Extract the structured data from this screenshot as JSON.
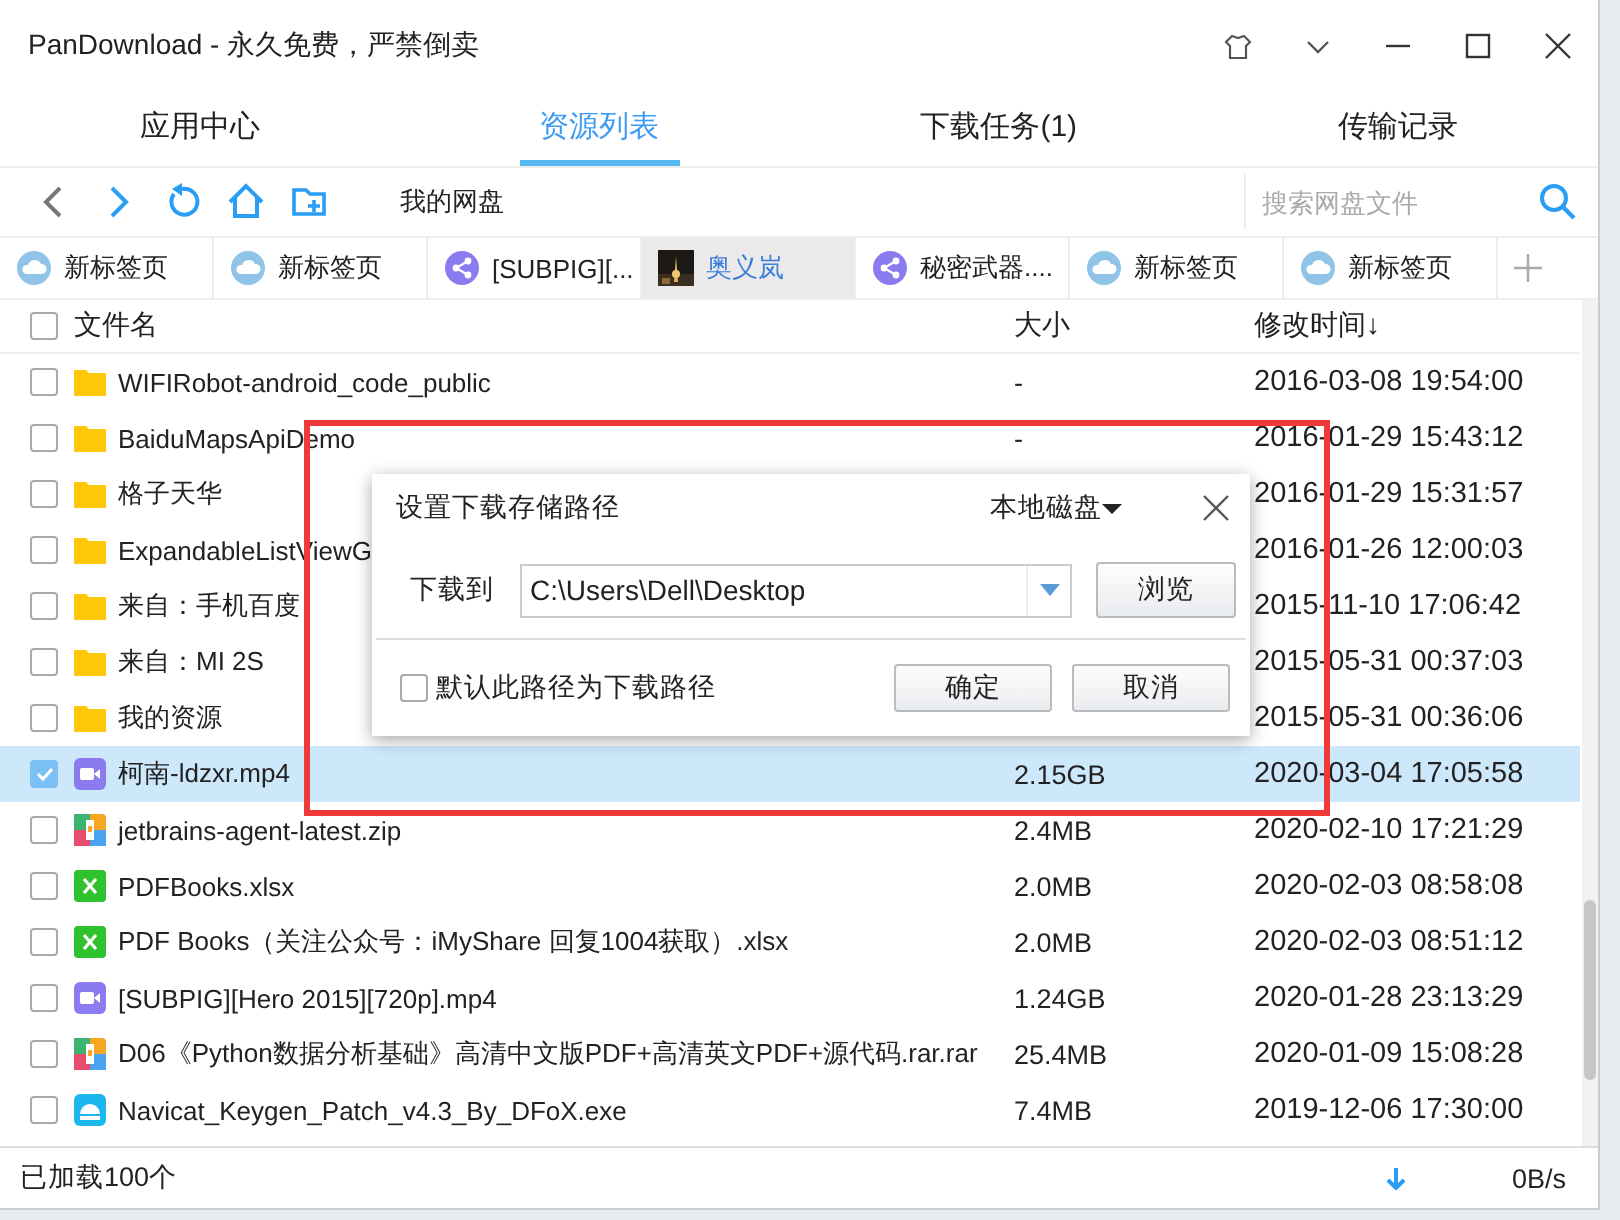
{
  "window": {
    "title": "PanDownload - 永久免费，严禁倒卖"
  },
  "nav_tabs": [
    {
      "label": "应用中心",
      "selected": false
    },
    {
      "label": "资源列表",
      "selected": true
    },
    {
      "label": "下载任务(1)",
      "selected": false
    },
    {
      "label": "传输记录",
      "selected": false
    }
  ],
  "toolbar": {
    "path": "我的网盘",
    "search": {
      "placeholder": "搜索网盘文件"
    }
  },
  "page_tabs": [
    {
      "label": "新标签页",
      "kind": "cloud",
      "selected": false
    },
    {
      "label": "新标签页",
      "kind": "cloud",
      "selected": false
    },
    {
      "label": "[SUBPIG][...",
      "kind": "share",
      "selected": false
    },
    {
      "label": "奥义岚",
      "kind": "picture",
      "selected": true
    },
    {
      "label": "秘密武器....",
      "kind": "share",
      "selected": false
    },
    {
      "label": "新标签页",
      "kind": "cloud",
      "selected": false
    },
    {
      "label": "新标签页",
      "kind": "cloud",
      "selected": false
    }
  ],
  "table": {
    "all_checked": false,
    "columns": [
      "文件名",
      "大小",
      "修改时间↓"
    ],
    "rows": [
      {
        "name": "WIFIRobot-android_code_public",
        "kind": "folder",
        "size": "-",
        "modified": "2016-03-08 19:54:00",
        "checked": false,
        "selected": false
      },
      {
        "name": "BaiduMapsApiDemo",
        "kind": "folder",
        "size": "-",
        "modified": "2016-01-29 15:43:12",
        "checked": false,
        "selected": false
      },
      {
        "name": "格子天华",
        "kind": "folder",
        "modified": "2016-01-29 15:31:57",
        "checked": false,
        "selected": false
      },
      {
        "name": "ExpandableListViewG",
        "kind": "folder",
        "modified": "2016-01-26 12:00:03",
        "checked": false,
        "selected": false
      },
      {
        "name": "来自：手机百度",
        "kind": "folder",
        "modified": "2015-11-10 17:06:42",
        "checked": false,
        "selected": false
      },
      {
        "name": "来自：MI 2S",
        "kind": "folder",
        "modified": "2015-05-31 00:37:03",
        "checked": false,
        "selected": false
      },
      {
        "name": "我的资源",
        "kind": "folder",
        "modified": "2015-05-31 00:36:06",
        "checked": false,
        "selected": false
      },
      {
        "name": "柯南-ldzxr.mp4",
        "kind": "video",
        "size": "2.15GB",
        "modified": "2020-03-04 17:05:58",
        "checked": true,
        "selected": true
      },
      {
        "name": "jetbrains-agent-latest.zip",
        "kind": "archive",
        "size": "2.4MB",
        "modified": "2020-02-10 17:21:29",
        "checked": false,
        "selected": false
      },
      {
        "name": "PDFBooks.xlsx",
        "kind": "sheet",
        "size": "2.0MB",
        "modified": "2020-02-03 08:58:08",
        "checked": false,
        "selected": false
      },
      {
        "name": "PDF Books（关注公众号：iMyShare 回复1004获取）.xlsx",
        "kind": "sheet",
        "size": "2.0MB",
        "modified": "2020-02-03 08:51:12",
        "checked": false,
        "selected": false
      },
      {
        "name": "[SUBPIG][Hero 2015][720p].mp4",
        "kind": "video",
        "size": "1.24GB",
        "modified": "2020-01-28 23:13:29",
        "checked": false,
        "selected": false
      },
      {
        "name": "D06《Python数据分析基础》高清中文版PDF+高清英文PDF+源代码.rar.rar",
        "kind": "archive",
        "size": "25.4MB",
        "modified": "2020-01-09 15:08:28",
        "checked": false,
        "selected": false
      },
      {
        "name": "Navicat_Keygen_Patch_v4.3_By_DFoX.exe",
        "kind": "app",
        "size": "7.4MB",
        "modified": "2019-12-06 17:30:00",
        "checked": false,
        "selected": false
      }
    ]
  },
  "status_bar": {
    "loaded": "已加载100个",
    "speed": "0B/s"
  },
  "dialog": {
    "title": "设置下载存储路径",
    "location": "本地磁盘",
    "label": "下载到",
    "path": "C:\\Users\\Dell\\Desktop",
    "browse": "浏览",
    "default_option": {
      "label": "默认此路径为下载路径",
      "checked": false
    },
    "buttons": [
      "确定",
      "取消"
    ]
  },
  "highlight_frame": true
}
